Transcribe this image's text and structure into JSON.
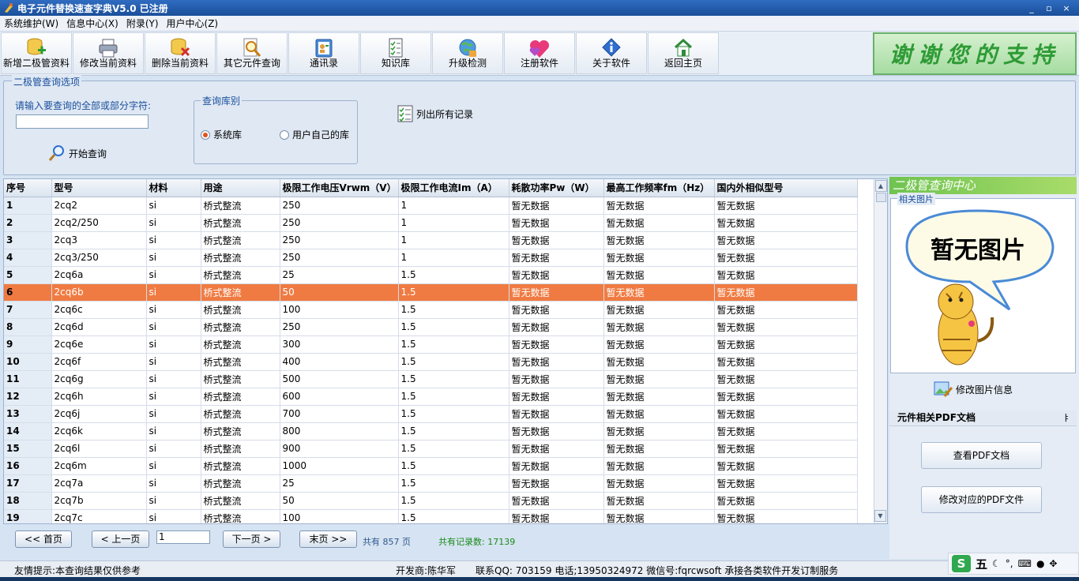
{
  "window": {
    "title": "电子元件替换速查字典V5.0 已注册",
    "controls": [
      "_",
      "▫",
      "×"
    ]
  },
  "menu": [
    "系统维护(W)",
    "信息中心(X)",
    "附录(Y)",
    "用户中心(Z)"
  ],
  "toolbar": [
    {
      "label": "新增二极管资料",
      "icon": "add-database-icon"
    },
    {
      "label": "修改当前资料",
      "icon": "printer-icon"
    },
    {
      "label": "删除当前资料",
      "icon": "delete-database-icon"
    },
    {
      "label": "其它元件查询",
      "icon": "search-document-icon"
    },
    {
      "label": "通讯录",
      "icon": "address-book-icon"
    },
    {
      "label": "知识库",
      "icon": "checklist-icon"
    },
    {
      "label": "升级检测",
      "icon": "globe-update-icon"
    },
    {
      "label": "注册软件",
      "icon": "hearts-icon"
    },
    {
      "label": "关于软件",
      "icon": "info-icon"
    },
    {
      "label": "返回主页",
      "icon": "home-icon"
    }
  ],
  "banner_text": "谢谢您的支持",
  "query": {
    "group_title": "二极管查询选项",
    "input_label": "请输入要查询的全部或部分字符:",
    "input_value": "",
    "start_label": "开始查询",
    "library_group_title": "查询库别",
    "radio_system": "系统库",
    "radio_user": "用户自己的库",
    "selected_library": "系统库",
    "list_all_label": "列出所有记录"
  },
  "table": {
    "columns": [
      "序号",
      "型号",
      "材料",
      "用途",
      "极限工作电压Vrwm（V）",
      "极限工作电流Im（A）",
      "耗散功率Pw（W）",
      "最高工作频率fm（Hz）",
      "国内外相似型号"
    ],
    "selected_row": 6,
    "rows": [
      [
        "1",
        "2cq2",
        "si",
        "桥式整流",
        "250",
        "1",
        "暂无数据",
        "暂无数据",
        "暂无数据"
      ],
      [
        "2",
        "2cq2/250",
        "si",
        "桥式整流",
        "250",
        "1",
        "暂无数据",
        "暂无数据",
        "暂无数据"
      ],
      [
        "3",
        "2cq3",
        "si",
        "桥式整流",
        "250",
        "1",
        "暂无数据",
        "暂无数据",
        "暂无数据"
      ],
      [
        "4",
        "2cq3/250",
        "si",
        "桥式整流",
        "250",
        "1",
        "暂无数据",
        "暂无数据",
        "暂无数据"
      ],
      [
        "5",
        "2cq6a",
        "si",
        "桥式整流",
        "25",
        "1.5",
        "暂无数据",
        "暂无数据",
        "暂无数据"
      ],
      [
        "6",
        "2cq6b",
        "si",
        "桥式整流",
        "50",
        "1.5",
        "暂无数据",
        "暂无数据",
        "暂无数据"
      ],
      [
        "7",
        "2cq6c",
        "si",
        "桥式整流",
        "100",
        "1.5",
        "暂无数据",
        "暂无数据",
        "暂无数据"
      ],
      [
        "8",
        "2cq6d",
        "si",
        "桥式整流",
        "250",
        "1.5",
        "暂无数据",
        "暂无数据",
        "暂无数据"
      ],
      [
        "9",
        "2cq6e",
        "si",
        "桥式整流",
        "300",
        "1.5",
        "暂无数据",
        "暂无数据",
        "暂无数据"
      ],
      [
        "10",
        "2cq6f",
        "si",
        "桥式整流",
        "400",
        "1.5",
        "暂无数据",
        "暂无数据",
        "暂无数据"
      ],
      [
        "11",
        "2cq6g",
        "si",
        "桥式整流",
        "500",
        "1.5",
        "暂无数据",
        "暂无数据",
        "暂无数据"
      ],
      [
        "12",
        "2cq6h",
        "si",
        "桥式整流",
        "600",
        "1.5",
        "暂无数据",
        "暂无数据",
        "暂无数据"
      ],
      [
        "13",
        "2cq6j",
        "si",
        "桥式整流",
        "700",
        "1.5",
        "暂无数据",
        "暂无数据",
        "暂无数据"
      ],
      [
        "14",
        "2cq6k",
        "si",
        "桥式整流",
        "800",
        "1.5",
        "暂无数据",
        "暂无数据",
        "暂无数据"
      ],
      [
        "15",
        "2cq6l",
        "si",
        "桥式整流",
        "900",
        "1.5",
        "暂无数据",
        "暂无数据",
        "暂无数据"
      ],
      [
        "16",
        "2cq6m",
        "si",
        "桥式整流",
        "1000",
        "1.5",
        "暂无数据",
        "暂无数据",
        "暂无数据"
      ],
      [
        "17",
        "2cq7a",
        "si",
        "桥式整流",
        "25",
        "1.5",
        "暂无数据",
        "暂无数据",
        "暂无数据"
      ],
      [
        "18",
        "2cq7b",
        "si",
        "桥式整流",
        "50",
        "1.5",
        "暂无数据",
        "暂无数据",
        "暂无数据"
      ],
      [
        "19",
        "2cq7c",
        "si",
        "桥式整流",
        "100",
        "1.5",
        "暂无数据",
        "暂无数据",
        "暂无数据"
      ]
    ]
  },
  "pager": {
    "first": "<< 首页",
    "prev": "< 上一页",
    "page_value": "1",
    "next": "下一页 >",
    "last": "末页 >>",
    "total_pages": "共有  857  页",
    "total_records": "共有记录数: 17139"
  },
  "right_panel": {
    "header": "二极管查询中心",
    "pic_group_title": "相关图片",
    "no_image_text": "暂无图片",
    "edit_pic_label": "修改图片信息",
    "pdf_section_title": "元件相关PDF文档",
    "pin_glyph": "ㅑ",
    "view_pdf": "查看PDF文档",
    "edit_pdf": "修改对应的PDF文件"
  },
  "status": {
    "tip": "友情提示:本查询结果仅供参考",
    "developer": "开发商:陈华军",
    "contact": "联系QQ: 703159 电话;13950324972 微信号:fqrcwsoft  承接各类软件开发订制服务"
  },
  "ime": {
    "logo": "S",
    "mode": "五"
  },
  "colors": {
    "selected_row": "#f07b42",
    "title_bar": "#2f6cc0",
    "banner_text": "#2e9b35",
    "record_count": "#198a19"
  }
}
